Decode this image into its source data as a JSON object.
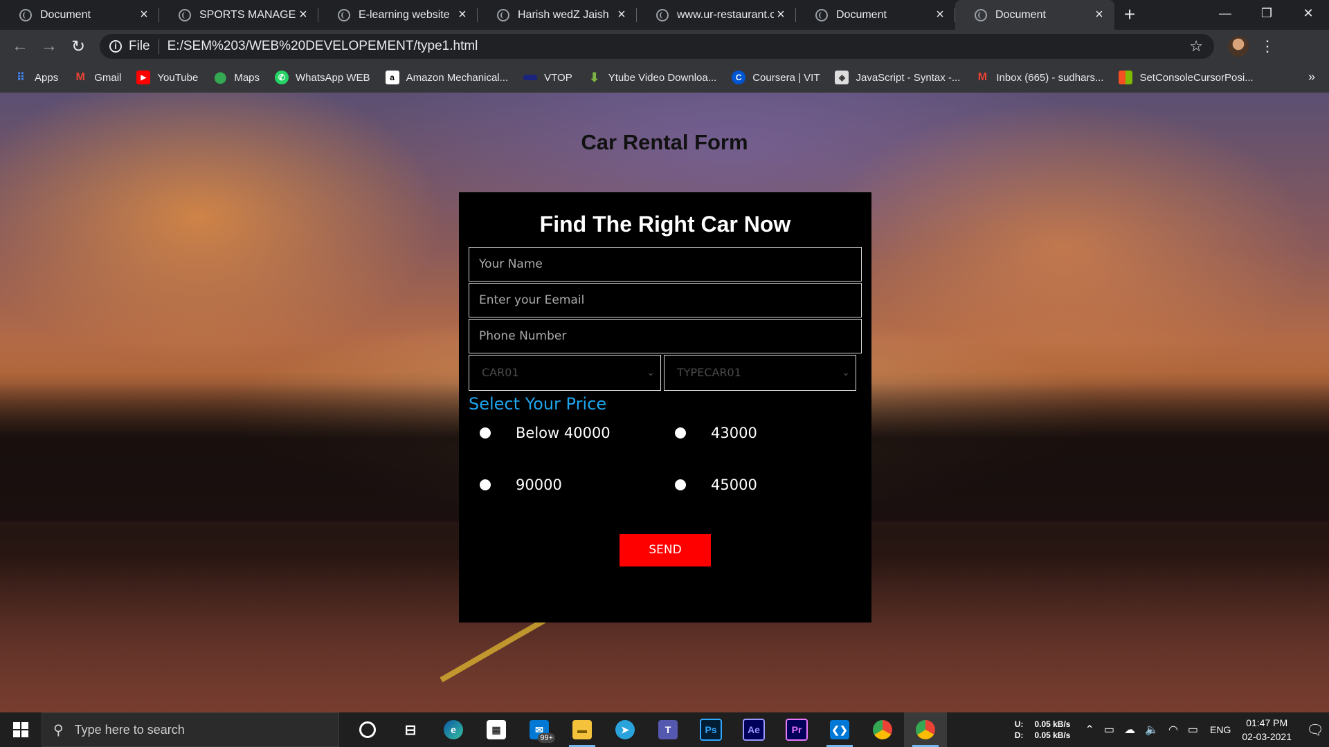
{
  "browser": {
    "tabs": [
      {
        "title": "Document",
        "active": false
      },
      {
        "title": "SPORTS MANAGEMEN",
        "active": false
      },
      {
        "title": "E-learning website",
        "active": false
      },
      {
        "title": "Harish wedZ Jaish",
        "active": false
      },
      {
        "title": "www.ur-restaurant.con",
        "active": false
      },
      {
        "title": "Document",
        "active": false
      },
      {
        "title": "Document",
        "active": true
      }
    ],
    "address": {
      "scheme_label": "File",
      "url": "E:/SEM%203/WEB%20DEVELOPEMENT/type1.html"
    },
    "bookmarks": [
      {
        "label": "Apps",
        "icon": "apps-grid-icon",
        "color": "#4285f4"
      },
      {
        "label": "Gmail",
        "icon": "gmail-icon",
        "color": "#ea4335"
      },
      {
        "label": "YouTube",
        "icon": "youtube-icon",
        "color": "#ff0000"
      },
      {
        "label": "Maps",
        "icon": "maps-icon",
        "color": "#34a853"
      },
      {
        "label": "WhatsApp WEB",
        "icon": "whatsapp-icon",
        "color": "#25d366"
      },
      {
        "label": "Amazon Mechanical...",
        "icon": "amazon-icon",
        "color": "#ffffff"
      },
      {
        "label": "VTOP",
        "icon": "vtop-icon",
        "color": "#1a237e"
      },
      {
        "label": "Ytube Video Downloa...",
        "icon": "download-arrow-icon",
        "color": "#7cb342"
      },
      {
        "label": "Coursera | VIT",
        "icon": "coursera-icon",
        "color": "#0056d2"
      },
      {
        "label": "JavaScript - Syntax -...",
        "icon": "javascript-site-icon",
        "color": "#dddddd"
      },
      {
        "label": "Inbox (665) - sudhars...",
        "icon": "gmail-icon",
        "color": "#ea4335"
      },
      {
        "label": "SetConsoleCursorPosi...",
        "icon": "microsoft-icon",
        "color": "#f25022"
      }
    ],
    "bookmarks_overflow": "»"
  },
  "page": {
    "title": "Car Rental Form",
    "form": {
      "heading": "Find The Right Car Now",
      "name_placeholder": "Your Name",
      "email_placeholder": "Enter your Eemail",
      "phone_placeholder": "Phone Number",
      "car_select_value": "CAR01",
      "type_select_value": "TYPECAR01",
      "price_heading": "Select Your Price",
      "price_options": [
        "Below 40000",
        "43000",
        "90000",
        "45000"
      ],
      "send_label": "SEND",
      "accent_color": "#1ea5ee",
      "button_color": "#ff0000"
    }
  },
  "taskbar": {
    "search_placeholder": "Type here to search",
    "mail_badge": "99+",
    "net_upload_label": "U:",
    "net_upload_value": "0.05 kB/s",
    "net_download_label": "D:",
    "net_download_value": "0.05 kB/s",
    "language": "ENG",
    "time": "01:47 PM",
    "date": "02-03-2021"
  }
}
